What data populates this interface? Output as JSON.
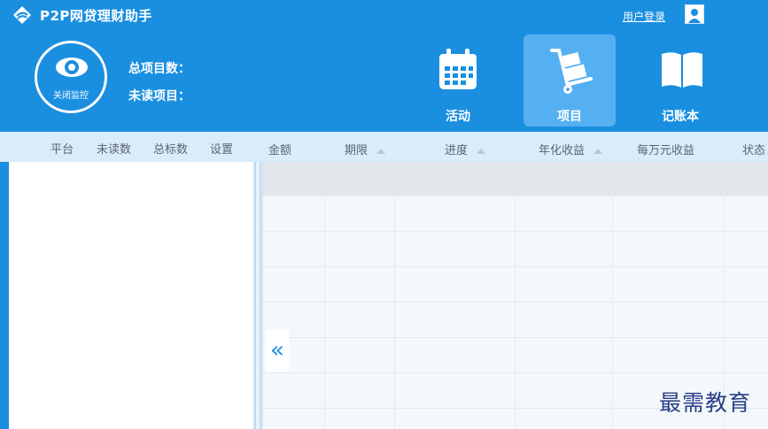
{
  "app": {
    "title": "P2P网贷理财助手",
    "login_label": "用户登录"
  },
  "icons": {
    "logo": "p2p-logo-icon",
    "user": "user-avatar-icon",
    "eye": "eye-icon",
    "calendar": "calendar-icon",
    "cart": "hand-truck-icon",
    "book": "open-book-icon",
    "collapse": "double-chevron-left-icon"
  },
  "monitor": {
    "label": "关闭监控"
  },
  "stats": {
    "total_label": "总项目数：",
    "unread_label": "未读项目："
  },
  "nav": [
    {
      "label": "活动"
    },
    {
      "label": "项目"
    },
    {
      "label": "记账本"
    }
  ],
  "left_columns": [
    "平台",
    "未读数",
    "总标数",
    "设置"
  ],
  "right_columns": [
    {
      "label": "金额"
    },
    {
      "label": "期限"
    },
    {
      "label": "进度"
    },
    {
      "label": "年化收益"
    },
    {
      "label": "每万元收益"
    },
    {
      "label": "状态"
    }
  ],
  "collapse_glyph": "«",
  "watermark": "最需教育",
  "colors": {
    "primary": "#1a8fe0",
    "active_tab": "#55b0f2",
    "header_strip": "#d9ecfb"
  }
}
